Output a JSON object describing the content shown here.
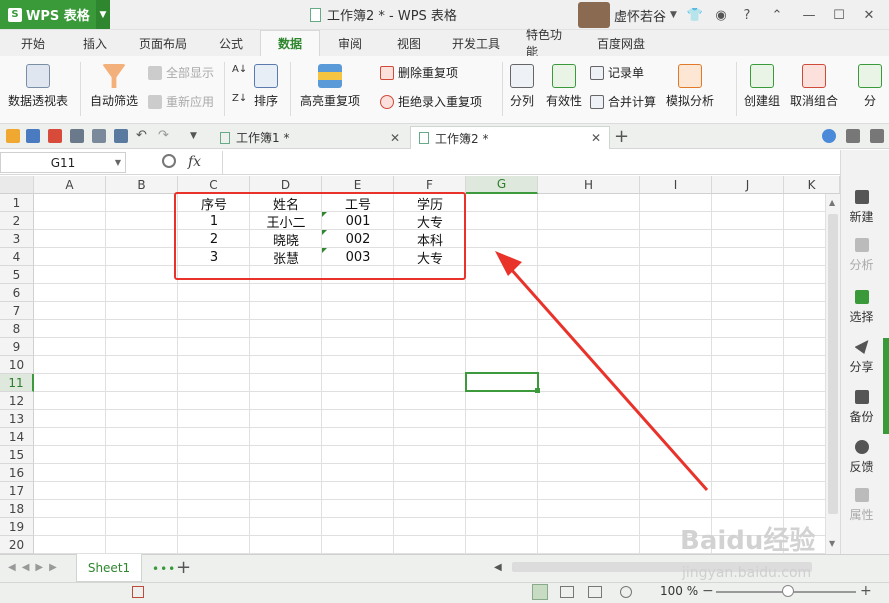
{
  "app": {
    "name": "WPS 表格",
    "window_title": "工作簿2 * - WPS 表格",
    "user": "虚怀若谷"
  },
  "ribbon_tabs": [
    "开始",
    "插入",
    "页面布局",
    "公式",
    "数据",
    "审阅",
    "视图",
    "开发工具",
    "特色功能",
    "百度网盘"
  ],
  "active_tab": "数据",
  "ribbon": {
    "pivot": "数据透视表",
    "autofilter": "自动筛选",
    "show_all": "全部显示",
    "reapply": "重新应用",
    "sort": "排序",
    "highlight_dup": "高亮重复项",
    "delete_dup": "删除重复项",
    "reject_dup": "拒绝录入重复项",
    "split": "分列",
    "validity": "有效性",
    "record": "记录单",
    "merge_calc": "合并计算",
    "sim_analysis": "模拟分析",
    "create_group": "创建组",
    "ungroup": "取消组合",
    "subtotal": "分"
  },
  "doc_tabs": [
    {
      "label": "工作簿1 *"
    },
    {
      "label": "工作簿2 *"
    }
  ],
  "namebox": "G11",
  "fx": "fx",
  "columns": [
    "A",
    "B",
    "C",
    "D",
    "E",
    "F",
    "G",
    "H",
    "I",
    "J",
    "K"
  ],
  "rows": [
    "1",
    "2",
    "3",
    "4",
    "5",
    "6",
    "7",
    "8",
    "9",
    "10",
    "11",
    "12",
    "13",
    "14",
    "15",
    "16",
    "17",
    "18",
    "19",
    "20"
  ],
  "table": {
    "headers": [
      "序号",
      "姓名",
      "工号",
      "学历"
    ],
    "rows": [
      [
        "1",
        "王小二",
        "001",
        "大专"
      ],
      [
        "2",
        "晓晓",
        "002",
        "本科"
      ],
      [
        "3",
        "张慧",
        "003",
        "大专"
      ]
    ]
  },
  "right_panel": [
    "新建",
    "分析",
    "选择",
    "分享",
    "备份",
    "反馈",
    "属性"
  ],
  "sheet": "Sheet1",
  "zoom": "100 %",
  "watermark": {
    "brand": "Baidu经验",
    "url": "jingyan.baidu.com"
  },
  "colors": {
    "accent": "#3a9a3a",
    "highlight": "#e8322a"
  }
}
